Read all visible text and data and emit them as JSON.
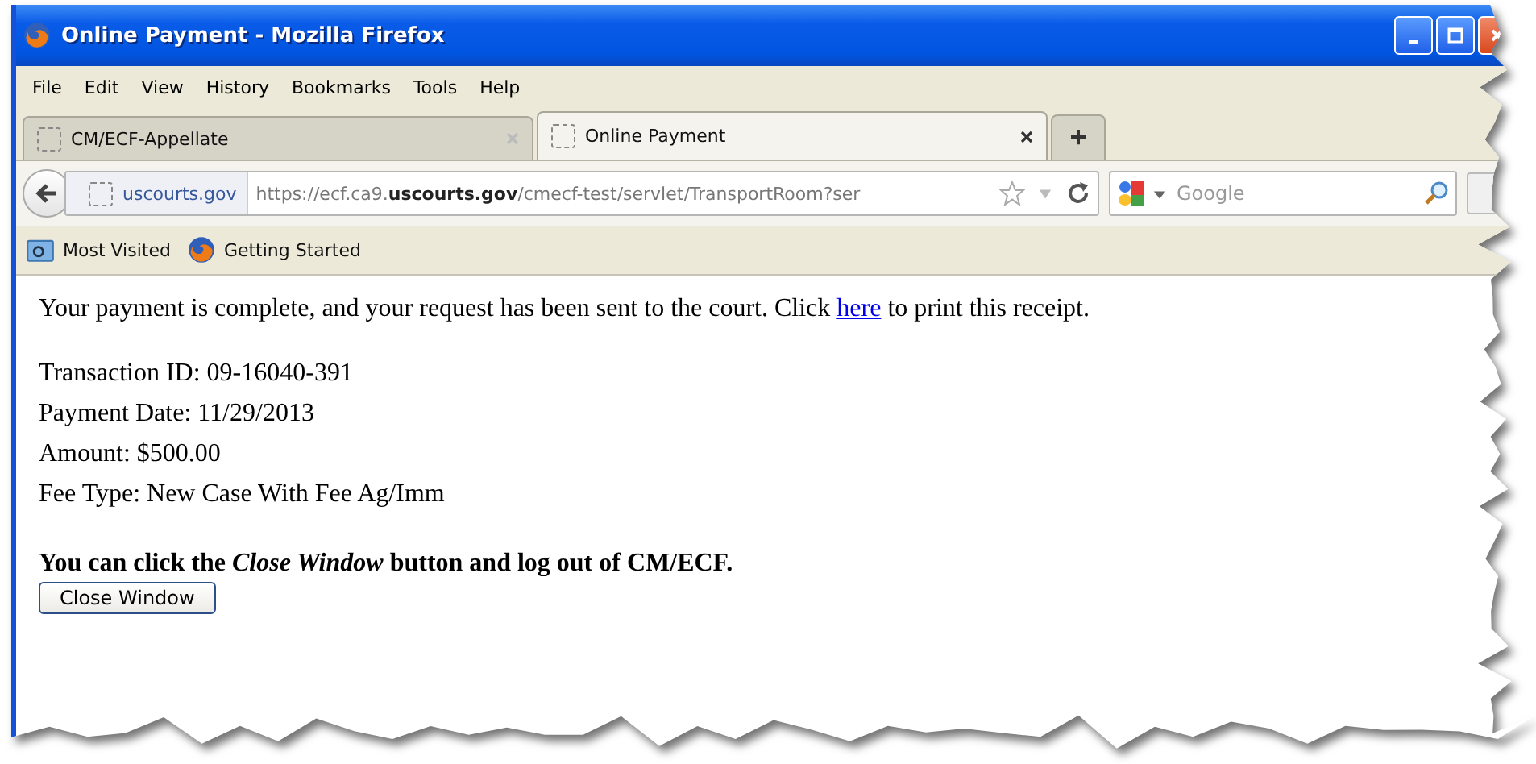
{
  "window": {
    "title": "Online Payment - Mozilla Firefox"
  },
  "menu": [
    "File",
    "Edit",
    "View",
    "History",
    "Bookmarks",
    "Tools",
    "Help"
  ],
  "tabs": [
    {
      "label": "CM/ECF-Appellate",
      "selected": false
    },
    {
      "label": "Online Payment",
      "selected": true
    }
  ],
  "new_tab": "+",
  "address_bar": {
    "site": "uscourts.gov",
    "url": "https://ecf.ca9.**uscourts.gov**/cmecf-test/servlet/TransportRoom?ser"
  },
  "search": {
    "placeholder": "Google"
  },
  "bookmarks": [
    "Most Visited",
    "Getting Started"
  ],
  "page": {
    "message": {
      "before": "Your payment is complete, and your request has been sent to the court. Click ",
      "link": "here",
      "after": " to print this receipt."
    },
    "details": [
      "Transaction ID: 09-16040-391",
      "Payment Date: 11/29/2013",
      "Amount: $500.00",
      "Fee Type: New Case With Fee Ag/Imm"
    ],
    "instruction": "You can click the *Close Window* button and log out of CM/ECF.",
    "button": "Close Window"
  }
}
